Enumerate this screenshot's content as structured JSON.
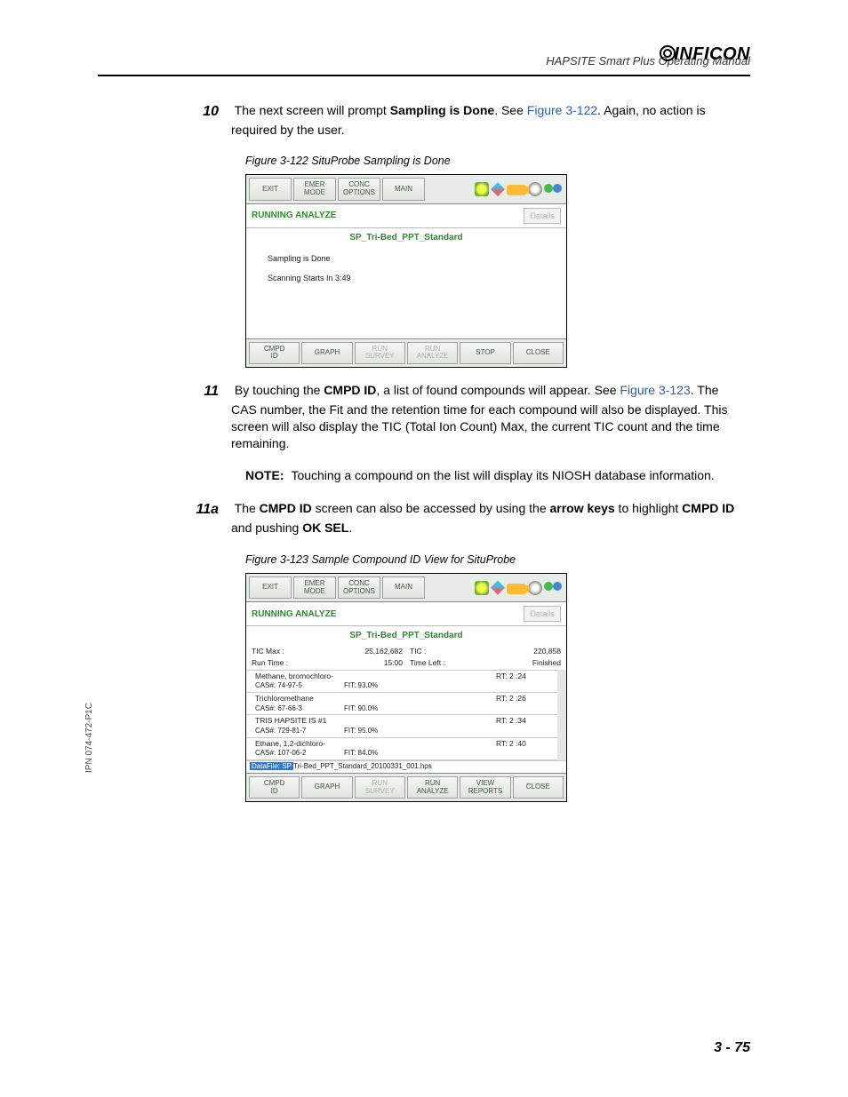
{
  "header": {
    "manual_title": "HAPSITE Smart Plus Operating Manual",
    "brand": "INFICON"
  },
  "sidebar": {
    "ipn": "IPN 074-472-P1C"
  },
  "footer": {
    "page": "3 - 75"
  },
  "shot_common": {
    "top_buttons": {
      "exit": "EXIT",
      "emer": "EMER\nMODE",
      "conc": "CONC\nOPTIONS",
      "main": "MAIN"
    },
    "status": "RUNNING ANALYZE",
    "details": "Details",
    "method": "SP_Tri-Bed_PPT_Standard"
  },
  "step10": {
    "num": "10",
    "text_before_bold": "The next screen will prompt ",
    "bold": "Sampling is Done",
    "text_after_bold": ". See ",
    "xref": "Figure 3-122",
    "text_tail": ". Again, no action is required by the user.",
    "fig_caption": "Figure 3-122  SituProbe Sampling is Done",
    "shot": {
      "msg1": "Sampling is Done",
      "msg2": "Scanning Starts In  3:49",
      "bottom": {
        "cmpd": "CMPD\nID",
        "graph": "GRAPH",
        "run_survey": "RUN\nSURVEY",
        "run_analyze": "RUN\nANALYZE",
        "stop": "STOP",
        "close": "CLOSE"
      }
    }
  },
  "step11": {
    "num": "11",
    "p1a": "By touching the ",
    "b1": "CMPD ID",
    "p1b": ", a list of found compounds will appear. See ",
    "xref": "Figure 3-123",
    "p1c": ". The CAS number, the Fit and the retention time for each compound will also be displayed. This screen will also display the TIC (Total Ion Count) Max, the current TIC count and the time remaining.",
    "note_label": "NOTE:",
    "note_text": "Touching a compound on the list will display its NIOSH database information."
  },
  "step11a": {
    "num": "11a",
    "t1": "The ",
    "b1": "CMPD ID",
    "t2": " screen can also be accessed by using the ",
    "b2": "arrow keys",
    "t3": " to highlight ",
    "b3": "CMPD ID",
    "t4": " and pushing ",
    "b4": "OK SEL",
    "t5": ".",
    "fig_caption": "Figure 3-123  Sample Compound ID View for SituProbe",
    "shot": {
      "tic_max_l": "TIC Max :",
      "tic_max_v": "25,162,682",
      "tic_l": "TIC :",
      "tic_v": "220,858",
      "run_time_l": "Run Time :",
      "run_time_v": "15:00",
      "time_left_l": "Time Left :",
      "time_left_v": "Finished",
      "compounds": [
        {
          "name": "Methane, bromochloro-",
          "rt": "RT: 2 :24",
          "cas": "CAS#: 74-97-5",
          "fit": "FIT:  93.0%"
        },
        {
          "name": "Trichloromethane",
          "rt": "RT: 2 :26",
          "cas": "CAS#: 67-66-3",
          "fit": "FIT:  90.0%"
        },
        {
          "name": "TRIS HAPSITE IS #1",
          "rt": "RT: 2 :34",
          "cas": "CAS#: 729-81-7",
          "fit": "FIT:  95.0%"
        },
        {
          "name": "Ethane, 1,2-dichloro-",
          "rt": "RT: 2 :40",
          "cas": "CAS#: 107-06-2",
          "fit": "FIT:  84.0%"
        }
      ],
      "datafile_label": "DataFile: SP",
      "datafile_rest": "Tri-Bed_PPT_Standard_20100331_001.hps",
      "bottom": {
        "cmpd": "CMPD\nID",
        "graph": "GRAPH",
        "run_survey": "RUN\nSURVEY",
        "run_analyze": "RUN\nANALYZE",
        "view_reports": "VIEW\nREPORTS",
        "close": "CLOSE"
      }
    }
  }
}
